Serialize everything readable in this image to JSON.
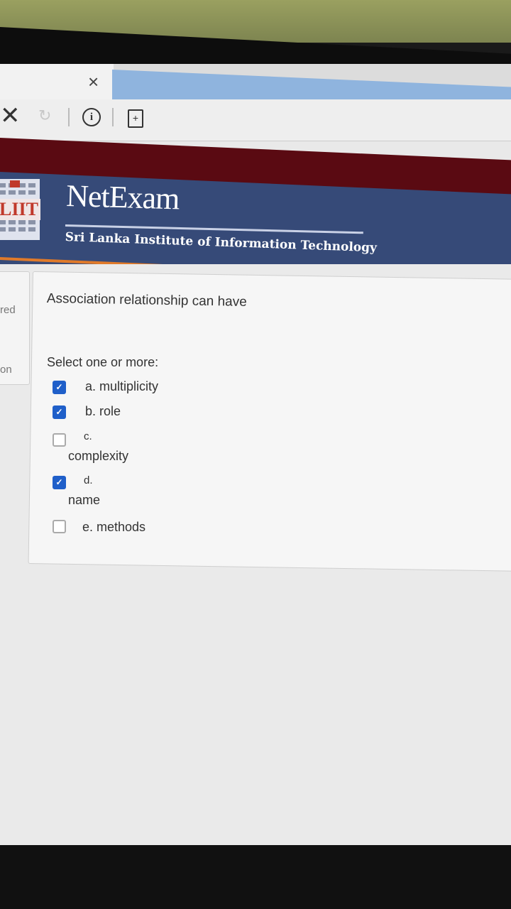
{
  "browser": {
    "tab_close_glyph": "×",
    "stop_glyph": "✕",
    "reload_glyph": "↻",
    "info_glyph": "i",
    "page_glyph": "+"
  },
  "header": {
    "logo_text": "LIIT",
    "title": "NetExam",
    "subtitle": "Sri Lanka Institute of Information Technology"
  },
  "sidebar": {
    "fragments": [
      "red",
      "on"
    ]
  },
  "question": {
    "text": "Association relationship can have",
    "prompt": "Select one or more:",
    "options": [
      {
        "letter": "a.",
        "text": "multiplicity",
        "checked": true
      },
      {
        "letter": "b.",
        "text": "role",
        "checked": true
      },
      {
        "letter": "c.",
        "text": "complexity",
        "checked": false
      },
      {
        "letter": "d.",
        "text": "name",
        "checked": true
      },
      {
        "letter": "e.",
        "text": "methods",
        "checked": false
      }
    ]
  },
  "colors": {
    "maroon": "#5a0a12",
    "banner_blue": "#364a78",
    "accent_orange": "#e07a2a",
    "checkbox_blue": "#1f5fc9"
  }
}
